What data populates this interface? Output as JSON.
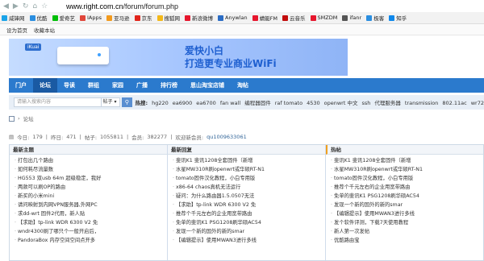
{
  "browser": {
    "url_host": "www.right.com.cn",
    "url_path": "/forum/forum.php"
  },
  "bookmarks": [
    {
      "label": "威锋网",
      "color": "#1aa3e8"
    },
    {
      "label": "优酷",
      "color": "#2a8ee0"
    },
    {
      "label": "爱奇艺",
      "color": "#00be06"
    },
    {
      "label": "IApps",
      "color": "#e0463a"
    },
    {
      "label": "亚马逊",
      "color": "#f29a1d"
    },
    {
      "label": "京东",
      "color": "#e1251b"
    },
    {
      "label": "搜狐网",
      "color": "#f3b81a"
    },
    {
      "label": "新浪微博",
      "color": "#e6162d"
    },
    {
      "label": "Anywlan",
      "color": "#2b6cc4"
    },
    {
      "label": "蜻蜓FM",
      "color": "#e6162d"
    },
    {
      "label": "云音乐",
      "color": "#c20c0c"
    },
    {
      "label": "SMZDM",
      "color": "#e6162d"
    },
    {
      "label": "ifanr",
      "color": "#555555"
    },
    {
      "label": "极客",
      "color": "#2a8ee0"
    },
    {
      "label": "知乎",
      "color": "#0f88eb"
    }
  ],
  "subbar": {
    "homepage": "设为首页",
    "favorite": "收藏本站"
  },
  "banner": {
    "logo": "iKuai",
    "line1": "爱快小白",
    "line2": "打造更专业商业WiFi"
  },
  "mainnav": [
    "门户",
    "论坛",
    "导读",
    "群组",
    "家园",
    "广播",
    "排行榜",
    "恩山淘宝店铺",
    "淘帖"
  ],
  "search": {
    "placeholder": "请输入搜索内容",
    "scope": "帖子",
    "hot_label": "热搜:",
    "hot_terms": [
      "hg220",
      "ea6900",
      "ea6700",
      "fan wall",
      "编程器固件",
      "raf tomato",
      "4530",
      "openwrt 中文",
      "ssh",
      "代理服务器",
      "transmission",
      "802.11ac",
      "wr72"
    ]
  },
  "breadcrumb": {
    "label": "论坛"
  },
  "stats": {
    "today_label": "今日:",
    "today": "179",
    "yesterday_label": "昨日:",
    "yesterday": "471",
    "posts_label": "帖子:",
    "posts": "1055811",
    "members_label": "会员:",
    "members": "382277",
    "newest_label": "欢迎新会员:",
    "newest": "qu1009633061"
  },
  "panels": [
    {
      "title": "最新主题",
      "items": [
        "打包出几个路由",
        "如何耗尽流量数",
        "HG553 双usb 64m 超级稳定，我好",
        "两款可以刷OP的路由",
        "新买的小米mini",
        "请问映射到内网VPN服务器,外网PC",
        "求dd-wrt 固件2代用，新人贴",
        "【求助】tp-link WDR 6300 V2 免",
        "wndr4300刷了哪只个一般开启后，",
        "PandoraBox 内存空间空间点开多"
      ]
    },
    {
      "title": "最新回复",
      "items": [
        "斐讯K1 斐讯1208全套固件（新增",
        "水星MW310R刷openwrt或华硕RT-N1",
        "tomato固件汉化教程，小白专用版",
        "x86-64 chaos真机无法运行",
        "疑问：为什么路由器1.5.0507无法",
        "【求助】tp-link WDR 6300 V2 免",
        "推荐个千元左右的企业用宽带路由",
        "免单的斐讯K1 PSG1208刷华硕AC54",
        "发现一个新的国外的新的smar",
        "【编辑提示】使用MWAN3进行多线"
      ]
    },
    {
      "title": "热帖",
      "items": [
        "斐讯K1 斐讯1208全套固件（新增",
        "水星MW310R刷openwrt或华硕RT-N1",
        "tomato固件汉化教程，小白专用版",
        "推荐个千元左右的企业用宽带路由",
        "免单的斐讯K1 PSG1208刷华硕AC54",
        "发现一个新的国外的新的smar",
        "【编辑提示】使用MWAN3进行多线",
        "发个软件评测，下载7天使用教程",
        "新人第一次发帖",
        "优酷路由宝"
      ]
    }
  ]
}
